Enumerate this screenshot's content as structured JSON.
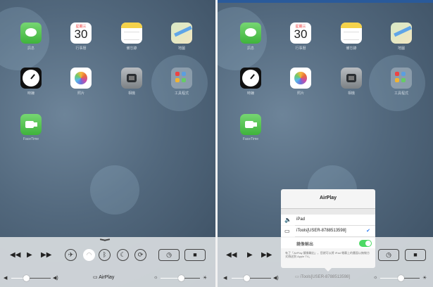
{
  "apps": {
    "messages": "訊息",
    "calendar_weekday": "星期三",
    "calendar_day": "30",
    "calendar": "行事曆",
    "notes": "備忘錄",
    "maps": "地圖",
    "clock": "時鐘",
    "photos": "照片",
    "camera": "相機",
    "folder": "工具程式",
    "facetime": "FaceTime"
  },
  "control_center": {
    "airplay_label": "AirPlay",
    "player_sub": "",
    "airplay_status": "iTools[USER-8788513598]"
  },
  "popup": {
    "title": "AirPlay",
    "devices": [
      {
        "label": "iPad",
        "icon": "speaker-icon",
        "selected": false
      },
      {
        "label": "iTools[USER-8788513598]",
        "icon": "tv-icon",
        "selected": true
      }
    ],
    "mirroring_label": "鏡像輸出",
    "mirroring_on": true,
    "note": "有了「AirPlay 鏡像輸出」，您就可以將 iPad 螢幕上的畫面以無線方式傳送到 Apple TV。"
  },
  "colors": {
    "toggle_on": "#4cd964",
    "checkmark": "#2a7bf2"
  }
}
